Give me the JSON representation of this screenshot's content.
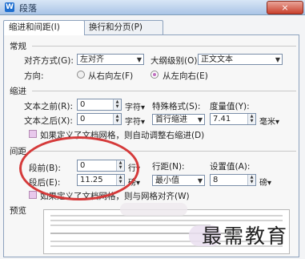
{
  "window": {
    "title": "段落",
    "icon": "W",
    "close_label": "×"
  },
  "tabs": [
    {
      "label": "缩进和间距(I)"
    },
    {
      "label": "换行和分页(P)"
    }
  ],
  "sections": {
    "general": "常规",
    "indent": "缩进",
    "spacing": "间距",
    "preview": "预览"
  },
  "general": {
    "align_label": "对齐方式(G):",
    "align_value": "左对齐",
    "outline_label": "大纲级别(O):",
    "outline_value": "正文文本",
    "direction_label": "方向:",
    "dir_rtl": "从右向左(F)",
    "dir_ltr": "从左向右(E)"
  },
  "indent": {
    "before_label": "文本之前(R):",
    "before_value": "0",
    "before_unit": "字符▾",
    "after_label": "文本之后(X):",
    "after_value": "0",
    "after_unit": "字符▾",
    "special_label": "特殊格式(S):",
    "special_value": "首行缩进",
    "measure_label": "度量值(Y):",
    "measure_value": "7.41",
    "measure_unit": "毫米▾",
    "grid_check": "如果定义了文档网格，则自动调整右缩进(D)"
  },
  "spacing": {
    "before_label": "段前(B):",
    "before_value": "0",
    "before_unit": "行▾",
    "after_label": "段后(E):",
    "after_value": "11.25",
    "after_unit": "磅▾",
    "line_label": "行距(N):",
    "line_value": "最小值",
    "setting_label": "设置值(A):",
    "setting_value": "8",
    "setting_unit": "磅▾",
    "grid_check": "如果定义了文档网格，则与网格对齐(W)"
  },
  "watermark": "最需教育",
  "colors": {
    "annotation": "#d53a3a",
    "accent": "#c070c0"
  }
}
